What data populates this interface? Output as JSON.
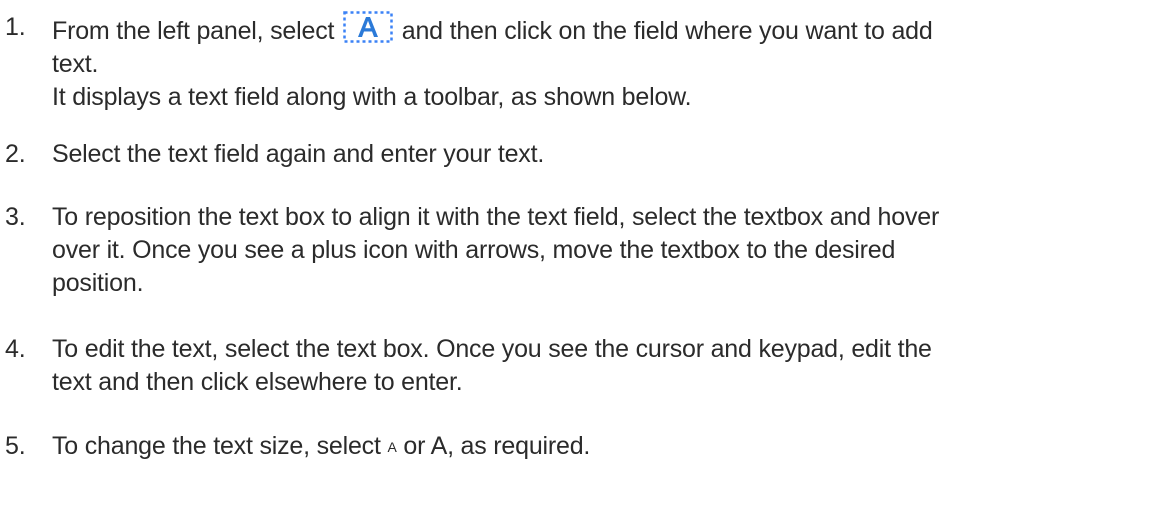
{
  "steps": [
    {
      "number": "1.",
      "text_before_icon": "From the left panel, select",
      "icon": "text-tool-icon",
      "text_after_icon": "and then click on the field where you want to add",
      "line2": "text.",
      "line3": "It displays a text field along with a toolbar, as shown below."
    },
    {
      "number": "2.",
      "line1": "Select the text field again and enter your text."
    },
    {
      "number": "3.",
      "line1": "To reposition the text box to align it with the text field, select the textbox and hover",
      "line2": "over it. Once you see a plus icon with arrows, move the textbox to the desired",
      "line3": "position."
    },
    {
      "number": "4.",
      "line1": "To edit the text, select the text box. Once you see the cursor and keypad, edit the",
      "line2": "text and then click elsewhere to enter."
    },
    {
      "number": "5.",
      "text_before": "To change the text size, select",
      "small_a": "A",
      "text_or": "or",
      "large_a": "A",
      "text_after": ", as required."
    }
  ],
  "colors": {
    "text": "#2b2b2b",
    "icon_blue": "#2b7ad8",
    "icon_border": "#3b82f6"
  }
}
